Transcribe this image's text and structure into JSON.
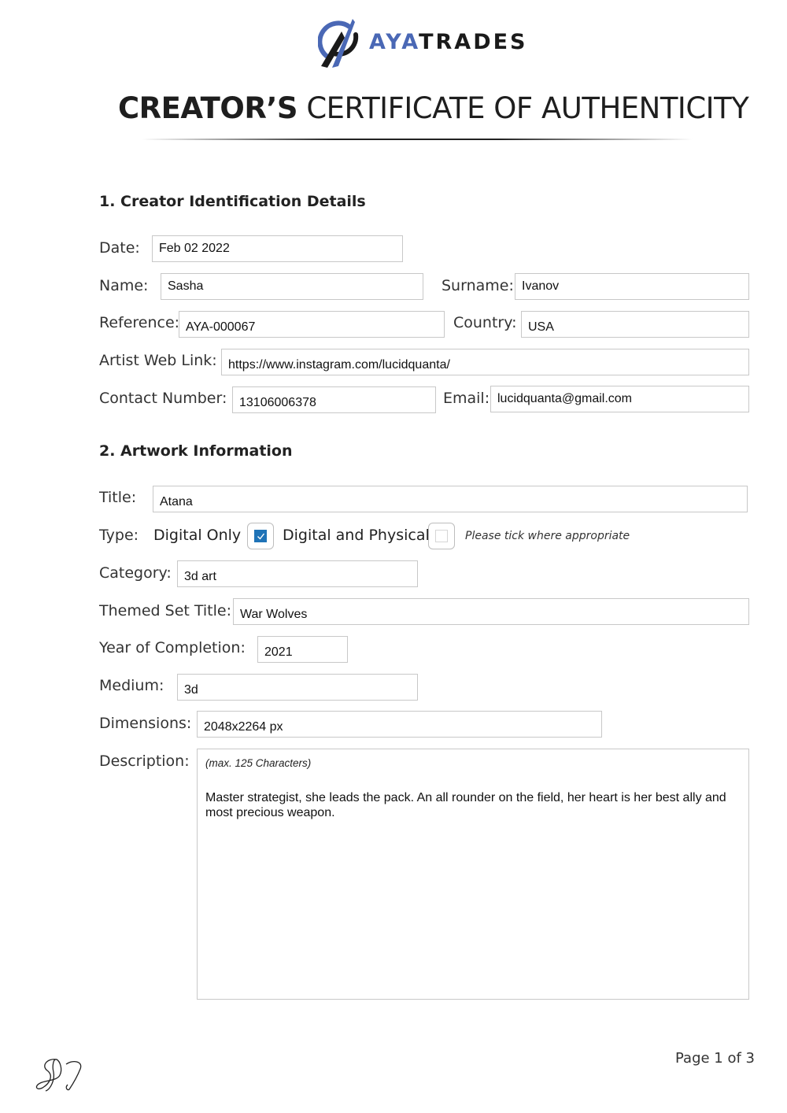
{
  "header": {
    "logo": {
      "icon": "ayatrades-logo-icon",
      "text_accent": "AYA",
      "text_main": "TRADES",
      "accent_color": "#4a68b5"
    },
    "title_bold": "CREATOR’S",
    "title_light": " CERTIFICATE OF AUTHENTICITY"
  },
  "section1": {
    "heading": "1. Creator Identification Details",
    "fields": {
      "date": {
        "label": "Date:",
        "value": "Feb 02 2022"
      },
      "name": {
        "label": "Name:",
        "value": "Sasha"
      },
      "surname": {
        "label": "Surname:",
        "value": "Ivanov"
      },
      "reference": {
        "label": "Reference:",
        "value": "AYA-000067"
      },
      "country": {
        "label": "Country:",
        "value": "USA"
      },
      "web_link": {
        "label": "Artist Web Link:",
        "value": "https://www.instagram.com/lucidquanta/"
      },
      "contact": {
        "label": "Contact Number:",
        "value": "13106006378"
      },
      "email": {
        "label": "Email:",
        "value": "lucidquanta@gmail.com"
      }
    }
  },
  "section2": {
    "heading": "2. Artwork Information",
    "title": {
      "label": "Title:",
      "value": "Atana"
    },
    "type": {
      "label": "Type:",
      "options": [
        {
          "label": "Digital Only",
          "checked": true
        },
        {
          "label": "Digital and Physical",
          "checked": false
        }
      ],
      "hint": "Please tick where appropriate",
      "check_color": "#1f73b7"
    },
    "category": {
      "label": "Category:",
      "value": "3d art"
    },
    "themed_set": {
      "label": "Themed Set Title:",
      "value": "War Wolves"
    },
    "year": {
      "label": "Year of Completion:",
      "value": "2021"
    },
    "medium": {
      "label": "Medium:",
      "value": "3d"
    },
    "dimensions": {
      "label": "Dimensions:",
      "value": "2048x2264 px"
    },
    "description": {
      "label": "Description:",
      "hint": "(max. 125 Characters)",
      "value": "Master strategist, she leads the pack. An all rounder on the field, her heart is her best ally and most precious weapon."
    }
  },
  "footer": {
    "signature": "signature-initials",
    "page_label": "Page 1 of 3"
  }
}
